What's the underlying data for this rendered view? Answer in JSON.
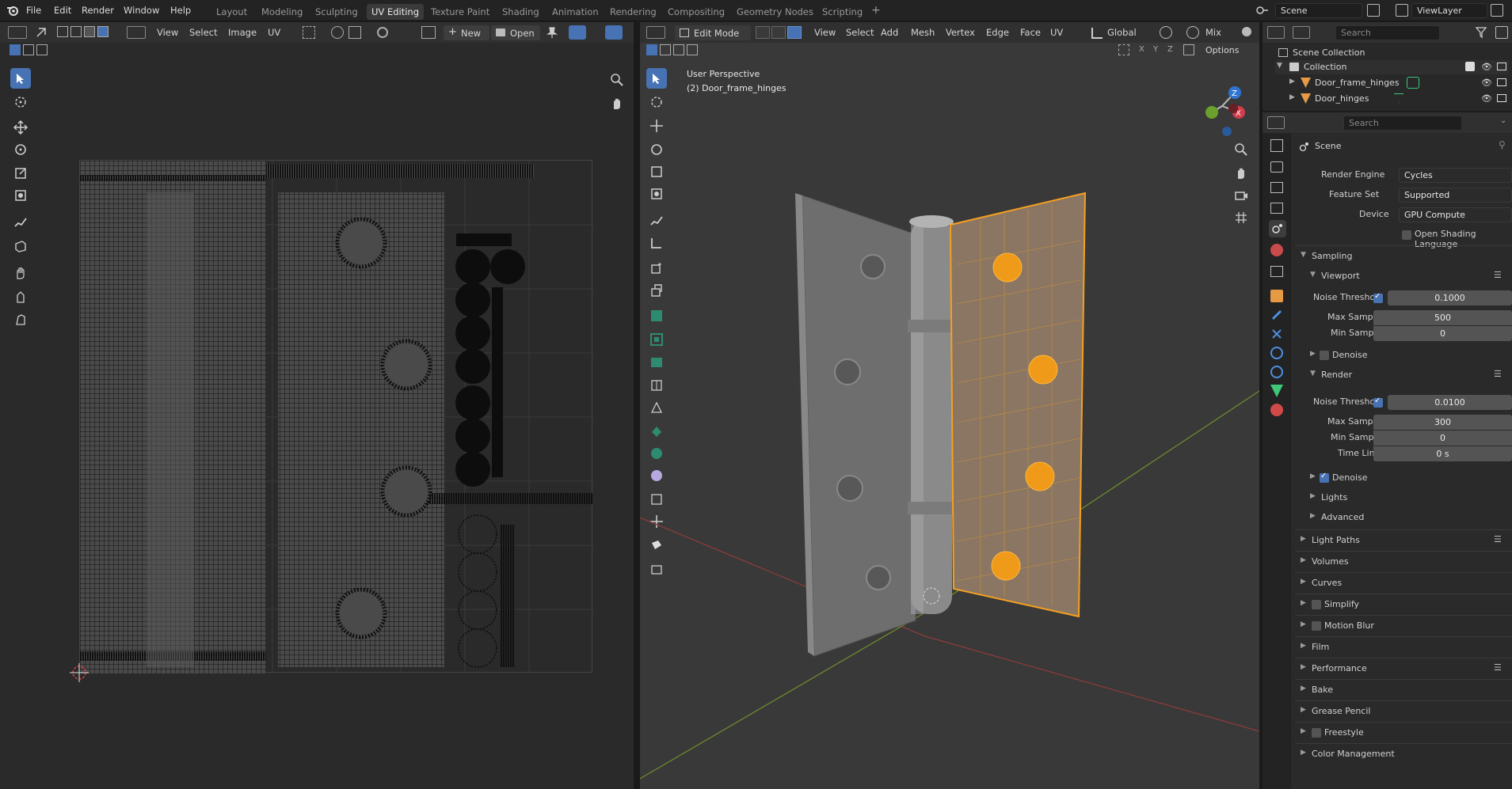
{
  "topbar": {
    "menus": [
      "File",
      "Edit",
      "Render",
      "Window",
      "Help"
    ],
    "workspaces": [
      "Layout",
      "Modeling",
      "Sculpting",
      "UV Editing",
      "Texture Paint",
      "Shading",
      "Animation",
      "Rendering",
      "Compositing",
      "Geometry Nodes",
      "Scripting"
    ],
    "active_workspace": "UV Editing",
    "scene_name": "Scene",
    "view_layer": "ViewLayer"
  },
  "uv_editor": {
    "menus": [
      "View",
      "Select",
      "Image",
      "UV"
    ],
    "new_label": "New",
    "open_label": "Open"
  },
  "viewport": {
    "mode": "Edit Mode",
    "menus": [
      "View",
      "Select",
      "Add",
      "Mesh",
      "Vertex",
      "Edge",
      "Face",
      "UV"
    ],
    "orientation": "Global",
    "shading": "Mix",
    "options_label": "Options",
    "overlay_title": "User Perspective",
    "overlay_object": "(2) Door_frame_hinges",
    "axes": [
      "X",
      "Y",
      "Z"
    ]
  },
  "outliner": {
    "search_placeholder": "Search",
    "scene_collection": "Scene Collection",
    "collection": "Collection",
    "objects": [
      "Door_frame_hinges",
      "Door_hinges"
    ]
  },
  "properties": {
    "search_placeholder": "Search",
    "context": "Scene",
    "render_engine_label": "Render Engine",
    "render_engine": "Cycles",
    "feature_set_label": "Feature Set",
    "feature_set": "Supported",
    "device_label": "Device",
    "device": "GPU Compute",
    "osl_label": "Open Shading Language",
    "sampling": "Sampling",
    "viewport": "Viewport",
    "noise_threshold_label": "Noise Threshold",
    "vp_noise_threshold": "0.1000",
    "max_samples_label": "Max Samples",
    "vp_max_samples": "500",
    "min_samples_label": "Min Samples",
    "vp_min_samples": "0",
    "denoise_label": "Denoise",
    "render": "Render",
    "r_noise_threshold": "0.0100",
    "r_max_samples": "300",
    "r_min_samples": "0",
    "time_limit_label": "Time Limit",
    "r_time_limit": "0 s",
    "lights": "Lights",
    "advanced": "Advanced",
    "panels": [
      "Light Paths",
      "Volumes",
      "Curves",
      "Simplify",
      "Motion Blur",
      "Film",
      "Performance",
      "Bake",
      "Grease Pencil",
      "Freestyle",
      "Color Management"
    ]
  },
  "colors": {
    "accent": "#4772b3",
    "selection": "#f5a020",
    "header": "#303030"
  }
}
